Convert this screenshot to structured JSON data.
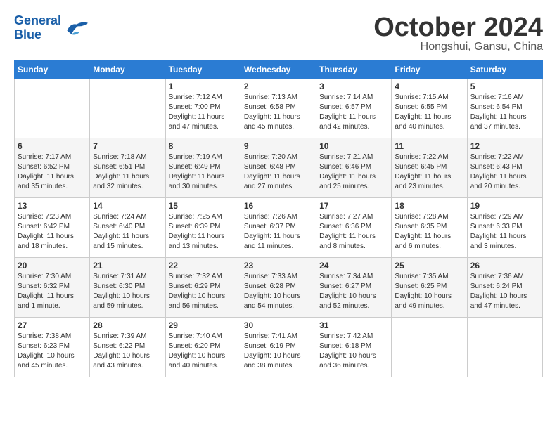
{
  "header": {
    "logo_line1": "General",
    "logo_line2": "Blue",
    "month": "October 2024",
    "location": "Hongshui, Gansu, China"
  },
  "days_of_week": [
    "Sunday",
    "Monday",
    "Tuesday",
    "Wednesday",
    "Thursday",
    "Friday",
    "Saturday"
  ],
  "weeks": [
    [
      {
        "day": "",
        "info": ""
      },
      {
        "day": "",
        "info": ""
      },
      {
        "day": "1",
        "info": "Sunrise: 7:12 AM\nSunset: 7:00 PM\nDaylight: 11 hours\nand 47 minutes."
      },
      {
        "day": "2",
        "info": "Sunrise: 7:13 AM\nSunset: 6:58 PM\nDaylight: 11 hours\nand 45 minutes."
      },
      {
        "day": "3",
        "info": "Sunrise: 7:14 AM\nSunset: 6:57 PM\nDaylight: 11 hours\nand 42 minutes."
      },
      {
        "day": "4",
        "info": "Sunrise: 7:15 AM\nSunset: 6:55 PM\nDaylight: 11 hours\nand 40 minutes."
      },
      {
        "day": "5",
        "info": "Sunrise: 7:16 AM\nSunset: 6:54 PM\nDaylight: 11 hours\nand 37 minutes."
      }
    ],
    [
      {
        "day": "6",
        "info": "Sunrise: 7:17 AM\nSunset: 6:52 PM\nDaylight: 11 hours\nand 35 minutes."
      },
      {
        "day": "7",
        "info": "Sunrise: 7:18 AM\nSunset: 6:51 PM\nDaylight: 11 hours\nand 32 minutes."
      },
      {
        "day": "8",
        "info": "Sunrise: 7:19 AM\nSunset: 6:49 PM\nDaylight: 11 hours\nand 30 minutes."
      },
      {
        "day": "9",
        "info": "Sunrise: 7:20 AM\nSunset: 6:48 PM\nDaylight: 11 hours\nand 27 minutes."
      },
      {
        "day": "10",
        "info": "Sunrise: 7:21 AM\nSunset: 6:46 PM\nDaylight: 11 hours\nand 25 minutes."
      },
      {
        "day": "11",
        "info": "Sunrise: 7:22 AM\nSunset: 6:45 PM\nDaylight: 11 hours\nand 23 minutes."
      },
      {
        "day": "12",
        "info": "Sunrise: 7:22 AM\nSunset: 6:43 PM\nDaylight: 11 hours\nand 20 minutes."
      }
    ],
    [
      {
        "day": "13",
        "info": "Sunrise: 7:23 AM\nSunset: 6:42 PM\nDaylight: 11 hours\nand 18 minutes."
      },
      {
        "day": "14",
        "info": "Sunrise: 7:24 AM\nSunset: 6:40 PM\nDaylight: 11 hours\nand 15 minutes."
      },
      {
        "day": "15",
        "info": "Sunrise: 7:25 AM\nSunset: 6:39 PM\nDaylight: 11 hours\nand 13 minutes."
      },
      {
        "day": "16",
        "info": "Sunrise: 7:26 AM\nSunset: 6:37 PM\nDaylight: 11 hours\nand 11 minutes."
      },
      {
        "day": "17",
        "info": "Sunrise: 7:27 AM\nSunset: 6:36 PM\nDaylight: 11 hours\nand 8 minutes."
      },
      {
        "day": "18",
        "info": "Sunrise: 7:28 AM\nSunset: 6:35 PM\nDaylight: 11 hours\nand 6 minutes."
      },
      {
        "day": "19",
        "info": "Sunrise: 7:29 AM\nSunset: 6:33 PM\nDaylight: 11 hours\nand 3 minutes."
      }
    ],
    [
      {
        "day": "20",
        "info": "Sunrise: 7:30 AM\nSunset: 6:32 PM\nDaylight: 11 hours\nand 1 minute."
      },
      {
        "day": "21",
        "info": "Sunrise: 7:31 AM\nSunset: 6:30 PM\nDaylight: 10 hours\nand 59 minutes."
      },
      {
        "day": "22",
        "info": "Sunrise: 7:32 AM\nSunset: 6:29 PM\nDaylight: 10 hours\nand 56 minutes."
      },
      {
        "day": "23",
        "info": "Sunrise: 7:33 AM\nSunset: 6:28 PM\nDaylight: 10 hours\nand 54 minutes."
      },
      {
        "day": "24",
        "info": "Sunrise: 7:34 AM\nSunset: 6:27 PM\nDaylight: 10 hours\nand 52 minutes."
      },
      {
        "day": "25",
        "info": "Sunrise: 7:35 AM\nSunset: 6:25 PM\nDaylight: 10 hours\nand 49 minutes."
      },
      {
        "day": "26",
        "info": "Sunrise: 7:36 AM\nSunset: 6:24 PM\nDaylight: 10 hours\nand 47 minutes."
      }
    ],
    [
      {
        "day": "27",
        "info": "Sunrise: 7:38 AM\nSunset: 6:23 PM\nDaylight: 10 hours\nand 45 minutes."
      },
      {
        "day": "28",
        "info": "Sunrise: 7:39 AM\nSunset: 6:22 PM\nDaylight: 10 hours\nand 43 minutes."
      },
      {
        "day": "29",
        "info": "Sunrise: 7:40 AM\nSunset: 6:20 PM\nDaylight: 10 hours\nand 40 minutes."
      },
      {
        "day": "30",
        "info": "Sunrise: 7:41 AM\nSunset: 6:19 PM\nDaylight: 10 hours\nand 38 minutes."
      },
      {
        "day": "31",
        "info": "Sunrise: 7:42 AM\nSunset: 6:18 PM\nDaylight: 10 hours\nand 36 minutes."
      },
      {
        "day": "",
        "info": ""
      },
      {
        "day": "",
        "info": ""
      }
    ]
  ]
}
